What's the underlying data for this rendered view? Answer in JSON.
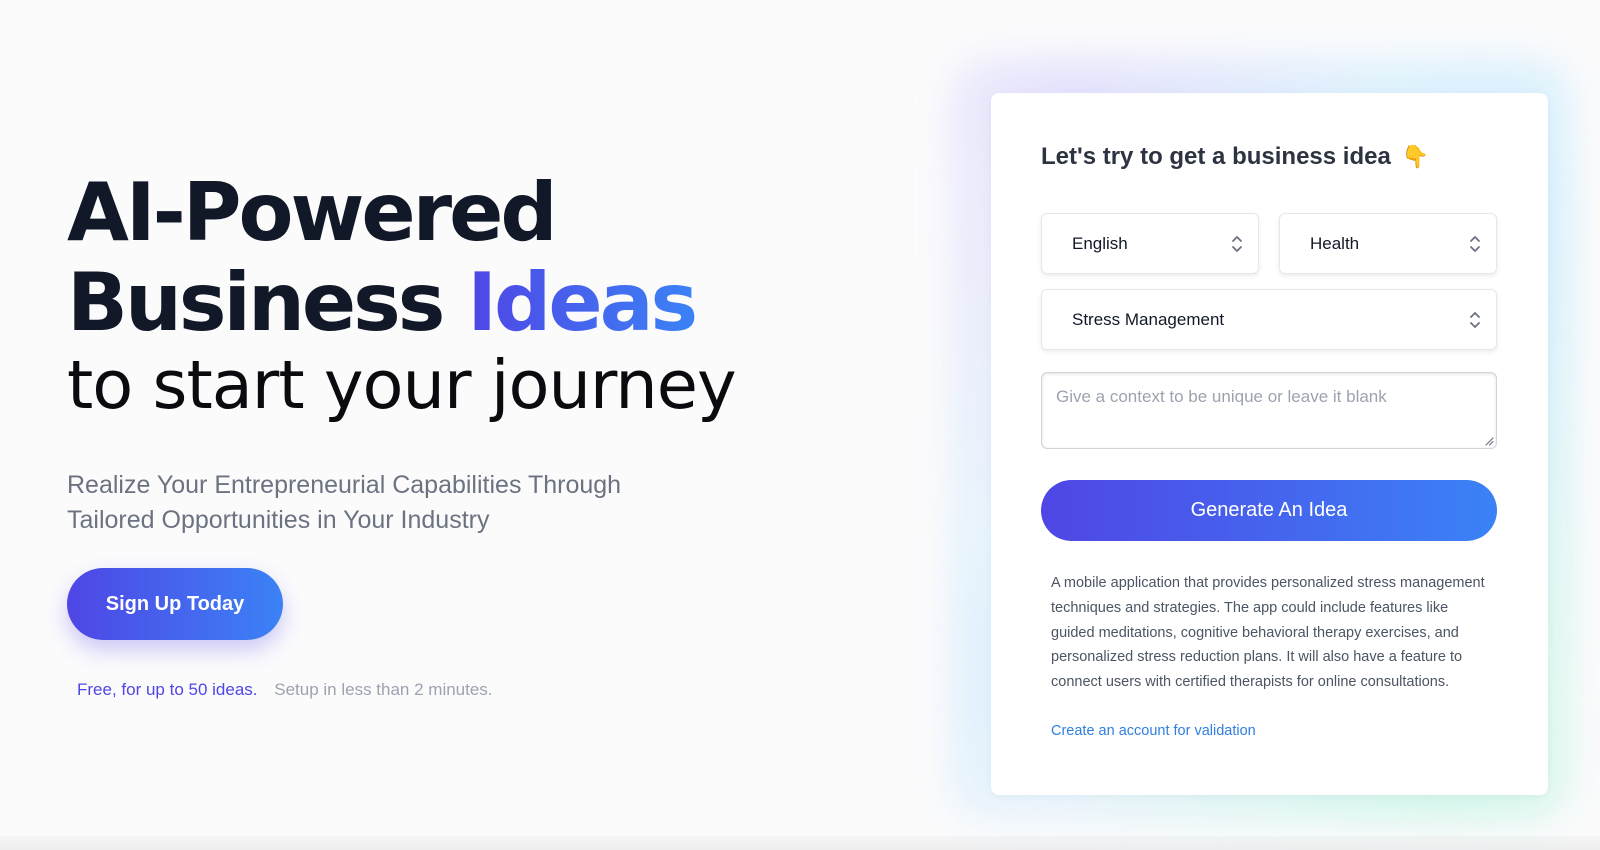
{
  "hero": {
    "title_line1": "AI-Powered",
    "title_line2_word1": "Business",
    "title_line2_accent": "Ideas",
    "subtitle": "to start your journey",
    "description": "Realize Your Entrepreneurial Capabilities Through Tailored Opportunities in Your Industry",
    "signup_label": "Sign Up Today",
    "note_free": "Free, for up to 50 ideas.",
    "note_setup": "Setup in less than 2 minutes."
  },
  "form": {
    "title": "Let's try to get a business idea",
    "title_emoji": "👇",
    "language": {
      "value": "English"
    },
    "industry": {
      "value": "Health"
    },
    "topic": {
      "value": "Stress Management"
    },
    "context": {
      "placeholder": "Give a context to be unique or leave it blank",
      "value": ""
    },
    "generate_label": "Generate An Idea",
    "result_text": "A mobile application that provides personalized stress management techniques and strategies. The app could include features like guided meditations, cognitive behavioral therapy exercises, and personalized stress reduction plans. It will also have a feature to connect users with certified therapists for online consultations.",
    "validation_link": "Create an account for validation"
  },
  "icons": {
    "select_chevron": "chevron-up-down-icon",
    "pointing_hand": "pointing-down-hand-icon"
  },
  "colors": {
    "accent_start": "#4f46e5",
    "accent_end": "#3b82f6",
    "link": "#2f7fe0"
  }
}
